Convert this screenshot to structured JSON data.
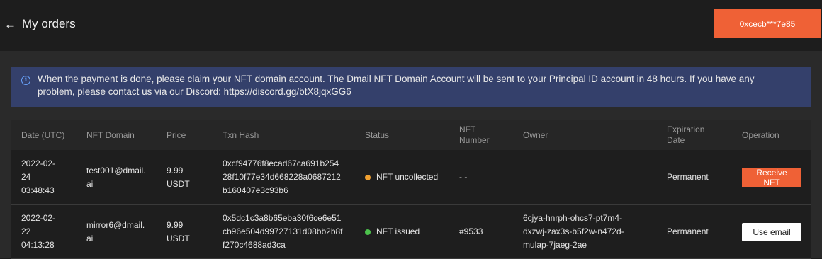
{
  "header": {
    "back_icon": "←",
    "title": "My orders",
    "wallet_label": "0xcecb***7e85"
  },
  "notice": {
    "icon": "info-icon",
    "line1": "When the payment is done, please claim your NFT domain account. The Dmail NFT Domain Account will be sent to your Principal ID account in 48 hours. If you have any",
    "line2": "problem, please contact us via our Discord: https://discord.gg/btX8jqxGG6"
  },
  "table": {
    "headers": {
      "date": "Date (UTC)",
      "domain": "NFT Domain",
      "price": "Price",
      "hash": "Txn Hash",
      "status": "Status",
      "num_line1": "NFT",
      "num_line2": "Number",
      "owner": "Owner",
      "exp_line1": "Expiration",
      "exp_line2": "Date",
      "op": "Operation"
    },
    "rows": [
      {
        "date1": "2022-02-",
        "date2": "24",
        "date3": "03:48:43",
        "domain1": "test001@dmail.",
        "domain2": "ai",
        "price1": "9.99",
        "price2": "USDT",
        "hash1": "0xcf94776f8ecad67ca691b254",
        "hash2": "28f10f77e34d668228a0687212",
        "hash3": "b160407e3c93b6",
        "status": "NFT uncollected",
        "status_color": "#f0a030",
        "number": "- -",
        "owner1": "",
        "owner2": "",
        "owner3": "",
        "expiration": "Permanent",
        "operation": "Receive NFT"
      },
      {
        "date1": "2022-02-",
        "date2": "22",
        "date3": "04:13:28",
        "domain1": "mirror6@dmail.",
        "domain2": "ai",
        "price1": "9.99",
        "price2": "USDT",
        "hash1": "0x5dc1c3a8b65eba30f6ce6e51",
        "hash2": "cb96e504d99727131d08bb2b8f",
        "hash3": "f270c4688ad3ca",
        "status": "NFT issued",
        "status_color": "#4cc24c",
        "number": "#9533",
        "owner1": "6cjya-hnrph-ohcs7-pt7m4-",
        "owner2": "dxzwj-zax3s-b5f2w-n472d-",
        "owner3": "mulap-7jaeg-2ae",
        "expiration": "Permanent",
        "operation": "Use email"
      }
    ]
  },
  "colors": {
    "accent": "#ef6136",
    "notice_bg": "#34406b",
    "info_icon": "#6aa5ff"
  }
}
